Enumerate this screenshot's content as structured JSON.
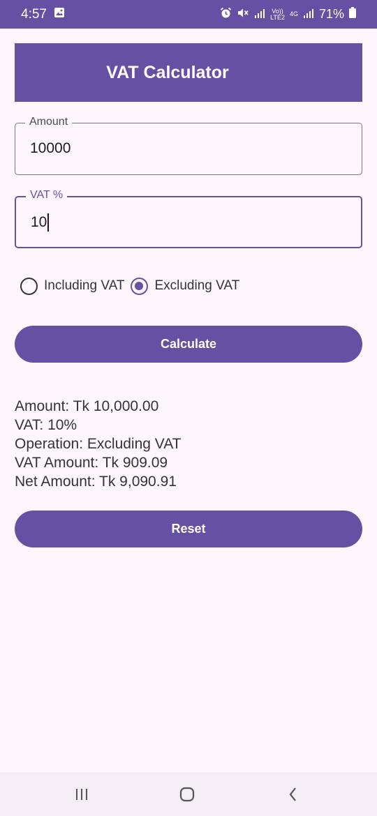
{
  "status_bar": {
    "time": "4:57",
    "volte_label": "Vo))",
    "lte_label": "LTE2",
    "network_label": "4G",
    "battery_percent": "71%"
  },
  "header": {
    "title": "VAT Calculator"
  },
  "form": {
    "amount": {
      "label": "Amount",
      "value": "10000"
    },
    "vat": {
      "label": "VAT %",
      "value": "10"
    },
    "radio_including": {
      "label": "Including VAT",
      "checked": false
    },
    "radio_excluding": {
      "label": "Excluding VAT",
      "checked": true
    },
    "calculate_label": "Calculate"
  },
  "results": {
    "amount_line": "Amount: Tk 10,000.00",
    "vat_line": "VAT: 10%",
    "operation_line": "Operation: Excluding VAT",
    "vat_amount_line": "VAT Amount: Tk 909.09",
    "net_amount_line": "Net Amount: Tk 9,090.91"
  },
  "reset_label": "Reset",
  "icons": {
    "status": [
      "gallery-icon",
      "alarm-icon",
      "mute-icon",
      "signal-icon",
      "battery-icon"
    ],
    "nav": [
      "recents-icon",
      "home-icon",
      "back-icon"
    ]
  },
  "colors": {
    "primary": "#6650a4",
    "background": "#fdf7fd",
    "text": "#333333"
  }
}
